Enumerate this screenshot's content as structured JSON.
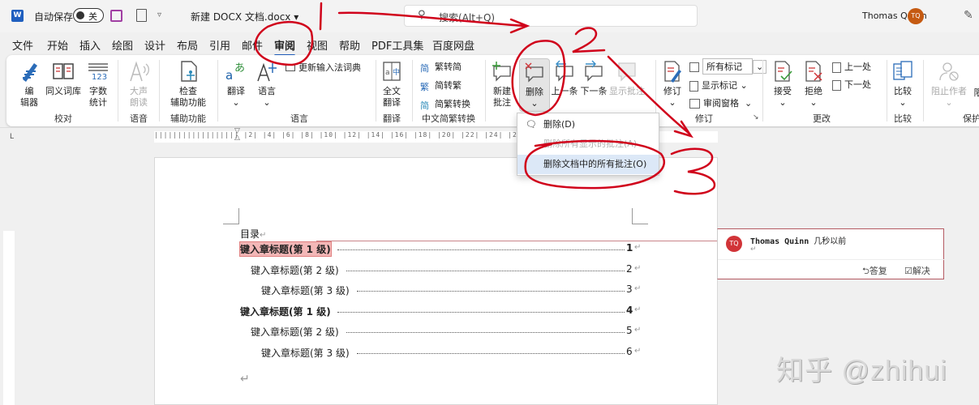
{
  "titlebar": {
    "app_icon": "word-icon",
    "autosave_label": "自动保存",
    "autosave_state": "关",
    "document_title": "新建 DOCX 文档.docx",
    "search_placeholder": "搜索(Alt+Q)",
    "user_name": "Thomas Quinn",
    "user_initials": "TQ"
  },
  "menu": {
    "tabs": [
      "文件",
      "开始",
      "插入",
      "绘图",
      "设计",
      "布局",
      "引用",
      "邮件",
      "审阅",
      "视图",
      "帮助",
      "PDF工具集",
      "百度网盘"
    ],
    "active": "审阅"
  },
  "ribbon": {
    "proofing": {
      "editor": "编\n辑器",
      "thesaurus": "同义词库",
      "word_count": "字数\n统计",
      "label": "校对"
    },
    "speech": {
      "read_aloud": "大声\n朗读",
      "label": "语音"
    },
    "accessibility": {
      "check": "检查\n辅助功能",
      "label": "辅助功能"
    },
    "language": {
      "translate": "翻译",
      "language": "语言",
      "update_ime": "更新输入法词典",
      "label": "语言"
    },
    "translation": {
      "full_translate": "全文\n翻译",
      "label": "翻译"
    },
    "chinese_conversion": {
      "to_simplified": "繁转简",
      "to_traditional": "简转繁",
      "convert": "简繁转换",
      "label": "中文简繁转换"
    },
    "comments": {
      "new": "新建\n批注",
      "delete": "删除",
      "previous": "上一条",
      "next": "下一条",
      "show": "显示批注"
    },
    "tracking": {
      "track_changes": "修订",
      "markup_select": "所有标记",
      "show_markup": "显示标记",
      "reviewing_pane": "审阅窗格",
      "label": "修订"
    },
    "changes": {
      "accept": "接受",
      "reject": "拒绝",
      "previous": "上一处",
      "next": "下一处",
      "label": "更改"
    },
    "compare": {
      "compare": "比较",
      "label": "比较"
    },
    "protect": {
      "block_authors": "阻止作者",
      "restrict": "限",
      "label": "保护"
    }
  },
  "dropdown": {
    "items": [
      {
        "label": "删除(D)",
        "state": "normal"
      },
      {
        "label": "删除所有显示的批注(A)",
        "state": "disabled"
      },
      {
        "label": "删除文档中的所有批注(O)",
        "state": "hover"
      }
    ]
  },
  "ruler": {
    "ticks": "|||||||||||||||||| |2| |4| |6| |8| |10| |12| |14| |16| |18| |20| |22| |24| |26| |28| ||||| ||||||"
  },
  "document": {
    "toc_title": "目录",
    "entries": [
      {
        "level": 1,
        "text": "键入章标题(第 1 级)",
        "page": "1"
      },
      {
        "level": 2,
        "text": "键入章标题(第 2 级)",
        "page": "2"
      },
      {
        "level": 3,
        "text": "键入章标题(第 3 级)",
        "page": "3"
      },
      {
        "level": 1,
        "text": "键入章标题(第 1 级)",
        "page": "4"
      },
      {
        "level": 2,
        "text": "键入章标题(第 2 级)",
        "page": "5"
      },
      {
        "level": 3,
        "text": "键入章标题(第 3 级)",
        "page": "6"
      }
    ],
    "return_mark": "↵"
  },
  "comment": {
    "initials": "TQ",
    "author": "Thomas Quinn",
    "time": "几秒以前",
    "reply": "答复",
    "resolve": "解决"
  },
  "annotations": [
    "1",
    "2",
    "3"
  ],
  "watermark": "知乎 @zhihui",
  "colors": {
    "accent": "#1f5fbf",
    "annotation": "#d0021b",
    "avatar_title": "#c55a11",
    "avatar_comment": "#d13438"
  }
}
